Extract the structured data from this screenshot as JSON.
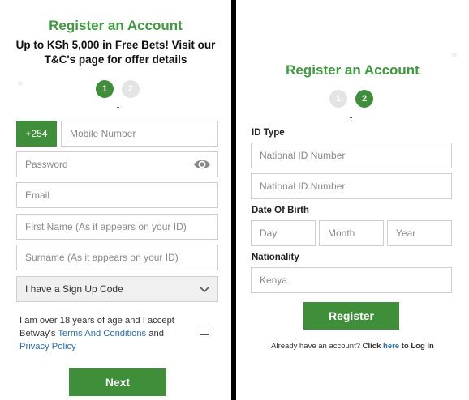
{
  "left": {
    "title": "Register an Account",
    "promo_line1": "Up to KSh 5,000 in Free Bets! Visit our",
    "promo_line2": "T&C's page for offer details",
    "steps": [
      "1",
      "2"
    ],
    "phone_prefix": "+254",
    "mobile_placeholder": "Mobile Number",
    "password_placeholder": "Password",
    "email_placeholder": "Email",
    "first_name_placeholder": "First Name (As it appears on your ID)",
    "surname_placeholder": "Surname (As it appears on your ID)",
    "signup_code_select": "I have a Sign Up Code",
    "consent_text_1": "I am over 18 years of age and I accept Betway's",
    "terms_link": "Terms And Conditions",
    "consent_and": "and",
    "privacy_link": "Privacy Policy",
    "next_button": "Next"
  },
  "right": {
    "title": "Register an Account",
    "steps": [
      "1",
      "2"
    ],
    "id_type_label": "ID Type",
    "id_type_value": "National ID Number",
    "id_number_placeholder": "National ID Number",
    "dob_label": "Date Of Birth",
    "day_placeholder": "Day",
    "month_placeholder": "Month",
    "year_placeholder": "Year",
    "nationality_label": "Nationality",
    "nationality_value": "Kenya",
    "register_button": "Register",
    "already_text": "Already have an account?",
    "click_text": "Click",
    "here_link": "here",
    "login_text": "to Log In"
  },
  "colors": {
    "brand_green": "#3e8e3a",
    "title_green": "#3e9a3e",
    "link_blue": "#2a6fb0"
  },
  "icons": {
    "password_toggle": "eye-icon",
    "select_caret": "chevron-down-icon"
  }
}
